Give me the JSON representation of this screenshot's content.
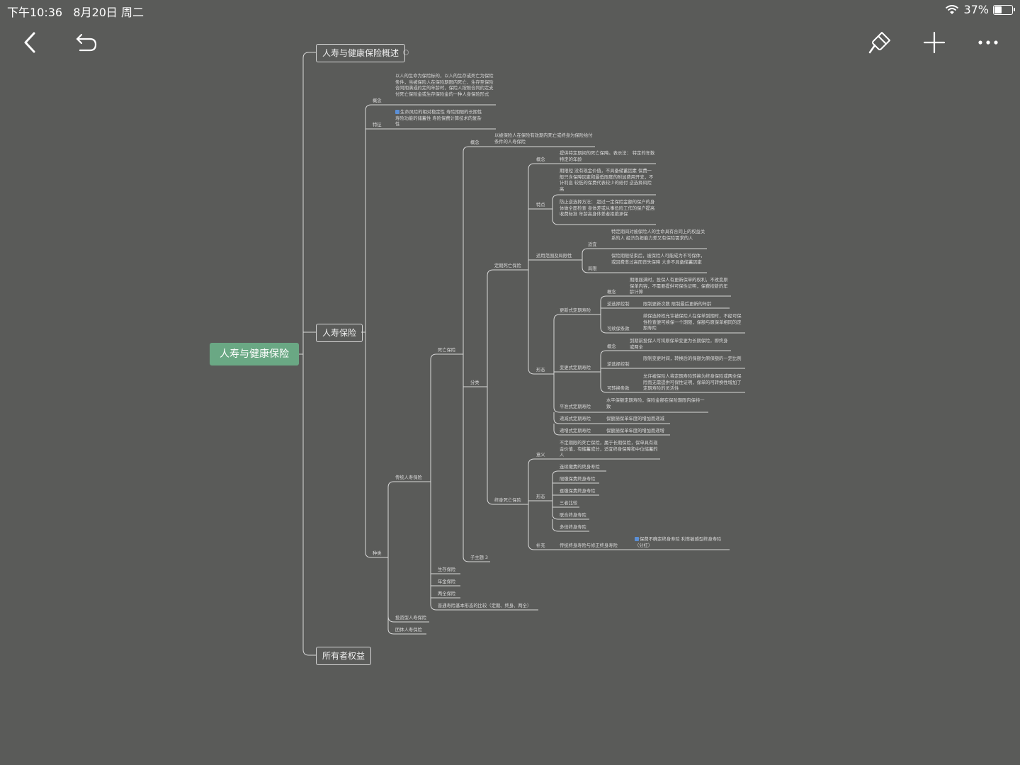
{
  "status": {
    "time": "下午10:36",
    "date": "8月20日 周二",
    "battery": "37%",
    "battery_level": 0.37
  },
  "icons": {
    "back": "chevron-left-icon",
    "undo": "undo-icon",
    "style": "brush-icon",
    "add": "plus-icon",
    "more": "more-icon",
    "wifi": "wifi-icon"
  },
  "colors": {
    "background": "#5a5b59",
    "root": "#6aa884",
    "line": "#d8d8d8"
  },
  "mindmap": {
    "root": "人寿与健康保险",
    "branch1": "人寿与健康保险概述",
    "branch2": "人寿保险",
    "branch3": "所有者权益",
    "gainian": "概念",
    "gainian_text": "以人的生命为保险标的，以人的生存或死亡为保险条件，当被保险人在保险期限内死亡、生存至保险合同期满或约定的年龄时，保险人按照合同约定支付死亡保险金或生存保险金的一种人身保险形式",
    "tezheng": "特征",
    "tezheng_text": "生命风险的相对稳定性 寿险期限的长期性 寿险功能的储蓄性 寿险保费计算技术的复杂性",
    "zhonglei": "种类",
    "chuantong": "传统人寿保险",
    "siwang": "死亡保险",
    "sw_gainian": "概念",
    "sw_gainian_text": "以被保险人在保险有效期内死亡或终身为保险给付条件的人寿保险",
    "fenlei": "分类",
    "dingqi": "定期死亡保险",
    "dq_gainian": "概念",
    "dq_gainian_text": "提供特定期间的死亡保障。表示法： 特定的年数 特定的年龄",
    "tedian": "特点",
    "tedian_text1": "期限短 没有现金价值，不具备储蓄因素 保费一般只含保障因素和最低限度的附加费用开支，不计利息 较低的保费代表较少的给付 逆选择风险高",
    "tedian_text2": "防止逆选择方法： 超过一定保险金额的保户的身体做全面检查 身体差或从事危险工作的保户提高收费标准 年龄高身体差者拒绝承保",
    "shiyong": "适用范围及局限性",
    "shiyi": "适宜",
    "shiyi_text": "特定期间对被保险人的生命具有合同上的权益关系的人 经济负担能力差又有保险需求的人",
    "juxian": "局限",
    "juxian_text": "保险期限结束后，被保险人可能成为不可保体，或因费率过高而丧失保障 大多不具备储蓄因素",
    "xingtai": "形态",
    "gengxin": "更新式定期寿险",
    "gx_gainian": "概念",
    "gx_gainian_text": "期限届满时，投保人有更新保单的权利，不改变原保单内容，不需要提供可保性证明，保费按新的年龄计算",
    "gx_nixuanze": "逆选择控制",
    "gx_nixuanze_text": "限制更新次数 限制最后更新的年龄",
    "gx_kexu": "可续保条款",
    "gx_kexu_text": "续保选择权允许被保险人在保单到期时，不经可保性检查便可续保一个期限，保额与原保单相同的定期寿险",
    "biangeng": "变更式定期寿险",
    "bg_gainian": "概念",
    "bg_gainian_text": "到期前投保人可将原保单变更为长期保险，即终身或两全",
    "bg_nixuanze": "逆选择控制",
    "bg_nixuanze_text": "限制变更时间，转换后的保额为原保额的一定比例",
    "bg_kezhuan": "可转换条款",
    "bg_kezhuan_text": "允许被保险人将定期寿险转换为终身保险或两全保险而无需提供可保性证明，保单的可转换性增加了定期寿险的灵活性",
    "pingzhun": "平准式定期寿险",
    "pingzhun_text": "水平保额定期寿险，保险金额在保险期限内保持一致",
    "dijian": "递减式定期寿险",
    "dijian_text": "保额随保单年度的增加而递减",
    "dizeng": "递增式定期寿险",
    "dizeng_text": "保额随保单年度的增加而递增",
    "zhongshen": "终身死亡保险",
    "zs_yiyi": "意义",
    "zs_yiyi_text": "不定期限的死亡保险，属于长期保险，保单具有现金价值，有储蓄成分，适宜终身保障和中位储蓄的人",
    "zs_xingtai": "形态",
    "zs_f1": "连续缴费的终身寿险",
    "zs_f2": "限缴保费终身寿险",
    "zs_f3": "趸缴保费终身寿险",
    "zs_f4": "三者比较",
    "zs_f5": "联合终身寿险",
    "zs_f6": "多倍终身寿险",
    "buchong": "补充",
    "buchong_item": "传统终身寿险与修正终身寿险",
    "buchong_text": "保费不确定终身寿险 利率敏感型终身寿险（分红）",
    "zizhuti": "子主题 3",
    "shengcun": "生存保险",
    "nianjin": "年金保险",
    "liangquan": "两全保险",
    "bijiao": "普通寿险基本形态的比较（定期、终身、两全）",
    "touzi": "投资型人寿保险",
    "tuanti": "团体人寿保险"
  }
}
